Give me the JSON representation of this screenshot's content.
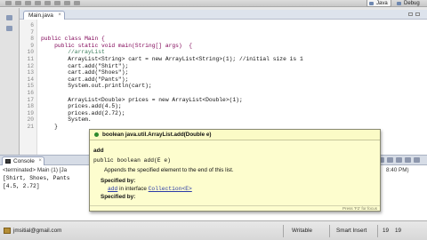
{
  "toolbar": {
    "perspectives": [
      {
        "label": "Java",
        "icon": "java-perspective-icon",
        "active": true
      },
      {
        "label": "Debug",
        "icon": "debug-perspective-icon",
        "active": false
      }
    ]
  },
  "editor": {
    "tab_label": "Main.java",
    "close_glyph": "×",
    "lines": [
      {
        "n": "6",
        "text": "",
        "style": "plain"
      },
      {
        "n": "7",
        "text": "",
        "style": "plain"
      },
      {
        "n": "8",
        "text": "public class Main {",
        "style": "kw"
      },
      {
        "n": "9",
        "text": "    public static void main(String[] args)  {",
        "style": "kw"
      },
      {
        "n": "10",
        "text": "        //arrayList",
        "style": "cm"
      },
      {
        "n": "11",
        "text": "        ArrayList<String> cart = new ArrayList<String>(1); //initial size is 1",
        "style": "plain"
      },
      {
        "n": "12",
        "text": "        cart.add(\"Shirt\");",
        "style": "plain"
      },
      {
        "n": "13",
        "text": "        cart.add(\"Shoes\");",
        "style": "plain"
      },
      {
        "n": "14",
        "text": "        cart.add(\"Pants\");",
        "style": "plain"
      },
      {
        "n": "15",
        "text": "        System.out.println(cart);",
        "style": "plain"
      },
      {
        "n": "16",
        "text": "",
        "style": "plain"
      },
      {
        "n": "17",
        "text": "        ArrayList<Double> prices = new ArrayList<Double>(1);",
        "style": "plain"
      },
      {
        "n": "18",
        "text": "        prices.add(4.5);",
        "style": "plain"
      },
      {
        "n": "19",
        "text": "        prices.add(2.72);",
        "style": "plain"
      },
      {
        "n": "20",
        "text": "        System.",
        "style": "plain"
      },
      {
        "n": "21",
        "text": "    }",
        "style": "plain"
      }
    ]
  },
  "console": {
    "tab_label": "Console",
    "status": "<terminated> Main (1) [Ja",
    "time": "8:40 PM)",
    "output": [
      "[Shirt, Shoes, Pants",
      "[4.5, 2.72]"
    ]
  },
  "javadoc": {
    "signature": "boolean java.util.ArrayList.add(Double e)",
    "method_name": "add",
    "declaration": "public boolean add(E e)",
    "description": "Appends the specified element to the end of this list.",
    "specified_by_label": "Specified by:",
    "specified_link": "add",
    "specified_middle": " in interface ",
    "specified_iface": "Collection<E>",
    "specified_by_label2": "Specified by:",
    "hint": "Press 'F2' for focus"
  },
  "statusbar": {
    "project": "jmsitial@gmail.com",
    "writable": "Writable",
    "insert_mode": "Smart Insert",
    "line": "19",
    "col": "19"
  }
}
